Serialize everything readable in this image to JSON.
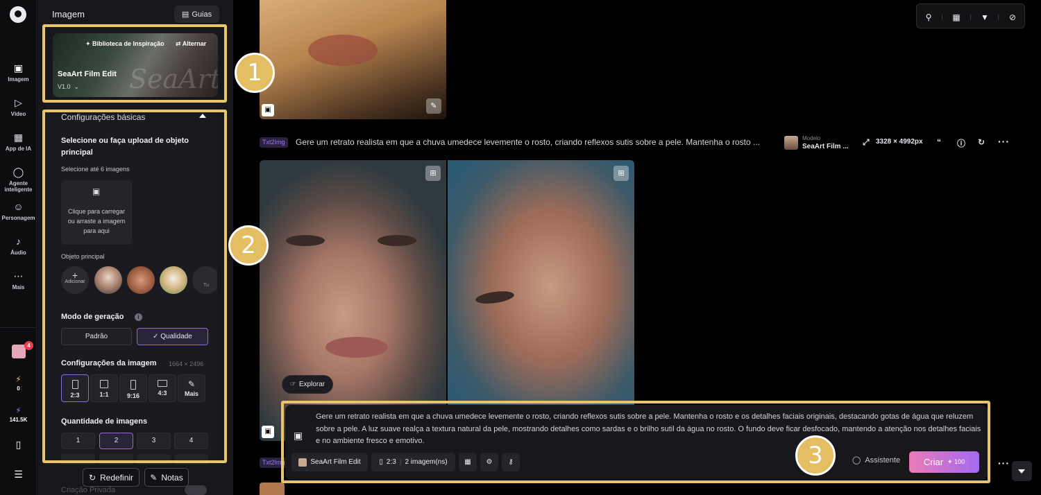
{
  "rail": {
    "items": [
      {
        "label": "Imagem",
        "icon": "image-icon"
      },
      {
        "label": "Vídeo",
        "icon": "video-icon"
      },
      {
        "label": "App de IA",
        "icon": "ai-app-icon"
      },
      {
        "label": "Agente inteligente",
        "icon": "agent-icon"
      },
      {
        "label": "Personagem",
        "icon": "character-icon"
      },
      {
        "label": "Áudio",
        "icon": "audio-icon"
      },
      {
        "label": "Mais",
        "icon": "more-icon"
      }
    ],
    "gift_badge": "4",
    "energy": "0",
    "credits": "141.5K"
  },
  "panel": {
    "title": "Imagem",
    "guides": "Guias",
    "model": {
      "library": "Biblioteca de Inspiração",
      "switch": "Alternar",
      "name": "SeaArt Film Edit",
      "version": "V1.0",
      "watermark": "SeaArt"
    },
    "section_title": "Configurações básicas",
    "upload_title": "Selecione ou faça upload de objeto principal",
    "upload_limit": "Selecione até 6 imagens",
    "upload_hint": "Clique para carregar ou arraste a imagem para aqui",
    "main_object": "Objeto principal",
    "add": "Adicionar",
    "tu": "Tu",
    "mode_title": "Modo de geração",
    "mode_options": [
      "Padrão",
      "Qualidade"
    ],
    "mode_selected": "Qualidade",
    "image_settings": "Configurações da imagem",
    "dimensions": "1664 × 2496",
    "ratios": [
      "2:3",
      "1:1",
      "9:16",
      "4:3",
      "Mais"
    ],
    "ratio_selected": "2:3",
    "quantity_title": "Quantidade de imagens",
    "quantities": [
      "1",
      "2",
      "3",
      "4"
    ],
    "quantity_selected": "2",
    "reset": "Redefinir",
    "notes": "Notas",
    "private": "Criação Privada"
  },
  "feed": {
    "tag": "Txt2Img",
    "prompt": "Gere um retrato realista em que a chuva umedece levemente o rosto, criando reflexos sutis sobre a pele. Mantenha o rosto ...",
    "model_label": "Modelo",
    "model_value": "SeaArt Film ...",
    "resolution": "3328 × 4992px",
    "explore": "Explorar"
  },
  "composer": {
    "prompt": "Gere um retrato realista em que a chuva umedece levemente o rosto, criando reflexos sutis sobre a pele. Mantenha o rosto e os detalhes faciais originais, destacando gotas de água que reluzem sobre a pele. A luz suave realça a textura natural da pele, mostrando detalhes como sardas e o brilho sutil da água no rosto. O fundo deve ficar desfocado, mantendo a atenção nos detalhes faciais e no ambiente fresco e emotivo.",
    "model": "SeaArt Film Edit",
    "ratio": "2:3",
    "count": "2 imagem(ns)",
    "assistant": "Assistente",
    "create": "Criar",
    "cost": "100"
  },
  "annotations": [
    "1",
    "2",
    "3"
  ],
  "colors": {
    "highlight": "#e8c56d",
    "accent_purple": "#8c6bd9",
    "create_gradient_start": "#e97ab8",
    "create_gradient_end": "#a36af0"
  }
}
